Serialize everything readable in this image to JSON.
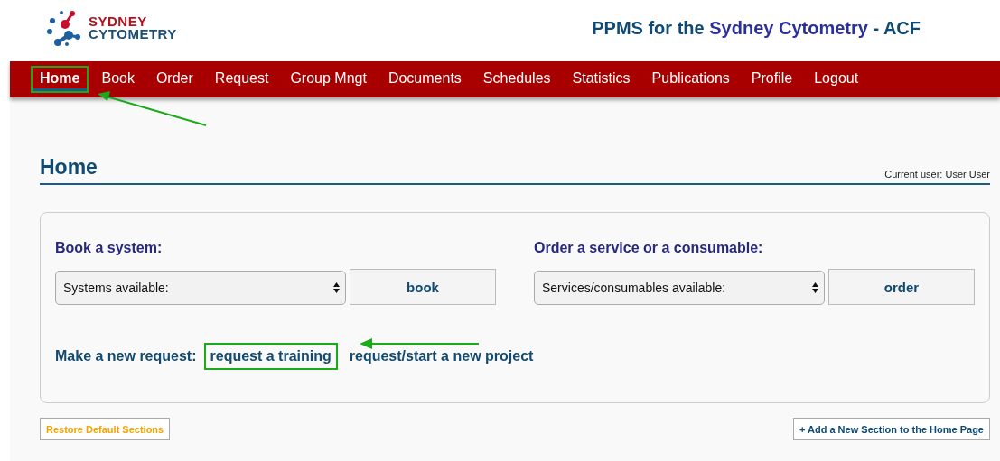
{
  "logo": {
    "line_1": "SYDNEY",
    "line_2": "CYTOMETRY"
  },
  "site_title": {
    "before": "PPMS for the",
    "name": "Sydney Cytometry",
    "after": "- ACF"
  },
  "nav": [
    {
      "label": "Home",
      "selected": true,
      "highlighted": true
    },
    {
      "label": "Book",
      "selected": false,
      "highlighted": false
    },
    {
      "label": "Order",
      "selected": false,
      "highlighted": false
    },
    {
      "label": "Request",
      "selected": false,
      "highlighted": false
    },
    {
      "label": "Group Mngt",
      "selected": false,
      "highlighted": false
    },
    {
      "label": "Documents",
      "selected": false,
      "highlighted": false
    },
    {
      "label": "Schedules",
      "selected": false,
      "highlighted": false
    },
    {
      "label": "Statistics",
      "selected": false,
      "highlighted": false
    },
    {
      "label": "Publications",
      "selected": false,
      "highlighted": false
    },
    {
      "label": "Profile",
      "selected": false,
      "highlighted": false
    },
    {
      "label": "Logout",
      "selected": false,
      "highlighted": false
    }
  ],
  "page": {
    "heading": "Home",
    "current_user": "Current user: User User"
  },
  "sections": [
    {
      "title": "Book a system:",
      "select": "Systems available:",
      "button": "book"
    },
    {
      "title": "Order a service or a consumable:",
      "select": "Services/consumables available:",
      "button": "order"
    }
  ],
  "request": {
    "label": "Make a new request:",
    "links": [
      {
        "label": "request a training",
        "highlighted": true
      },
      {
        "label": "request/start a new project",
        "highlighted": false
      }
    ]
  },
  "footer_buttons": {
    "restore": "Restore Default Sections",
    "add": "+ Add a New Section to the Home Page"
  }
}
